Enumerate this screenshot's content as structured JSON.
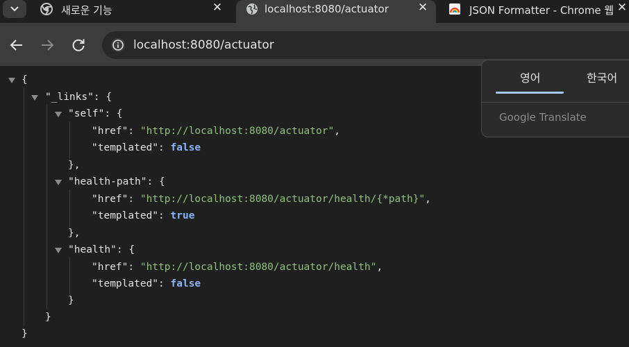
{
  "tabs": [
    {
      "title": "새로운 기능",
      "close": "✕",
      "icon": "chrome-icon"
    },
    {
      "title": "localhost:8080/actuator",
      "close": "✕",
      "icon": "globe-icon",
      "active": true
    },
    {
      "title": "JSON Formatter - Chrome 웹",
      "close": "✕",
      "icon": "json-formatter-icon"
    }
  ],
  "toolbar": {
    "url": "localhost:8080/actuator",
    "back": "back-arrow-icon",
    "forward": "forward-arrow-icon",
    "reload": "reload-icon"
  },
  "json": {
    "open_brace": "{",
    "links_key": "\"_links\"",
    "self_key": "\"self\"",
    "href_key": "\"href\"",
    "templated_key": "\"templated\"",
    "health_path_key": "\"health-path\"",
    "health_key": "\"health\"",
    "self_href": "\"http://localhost:8080/actuator\"",
    "health_path_href": "\"http://localhost:8080/actuator/health/{*path}\"",
    "health_href": "\"http://localhost:8080/actuator/health\"",
    "false_val": "false",
    "true_val": "true",
    "close_comma": "},",
    "close": "}"
  },
  "translate": {
    "lang_en": "영어",
    "lang_ko": "한국어",
    "brand": "Google Translate"
  },
  "colors": {
    "string": "#8ec07c",
    "boolean": "#8ab4f8",
    "text": "#e3e3e3"
  }
}
